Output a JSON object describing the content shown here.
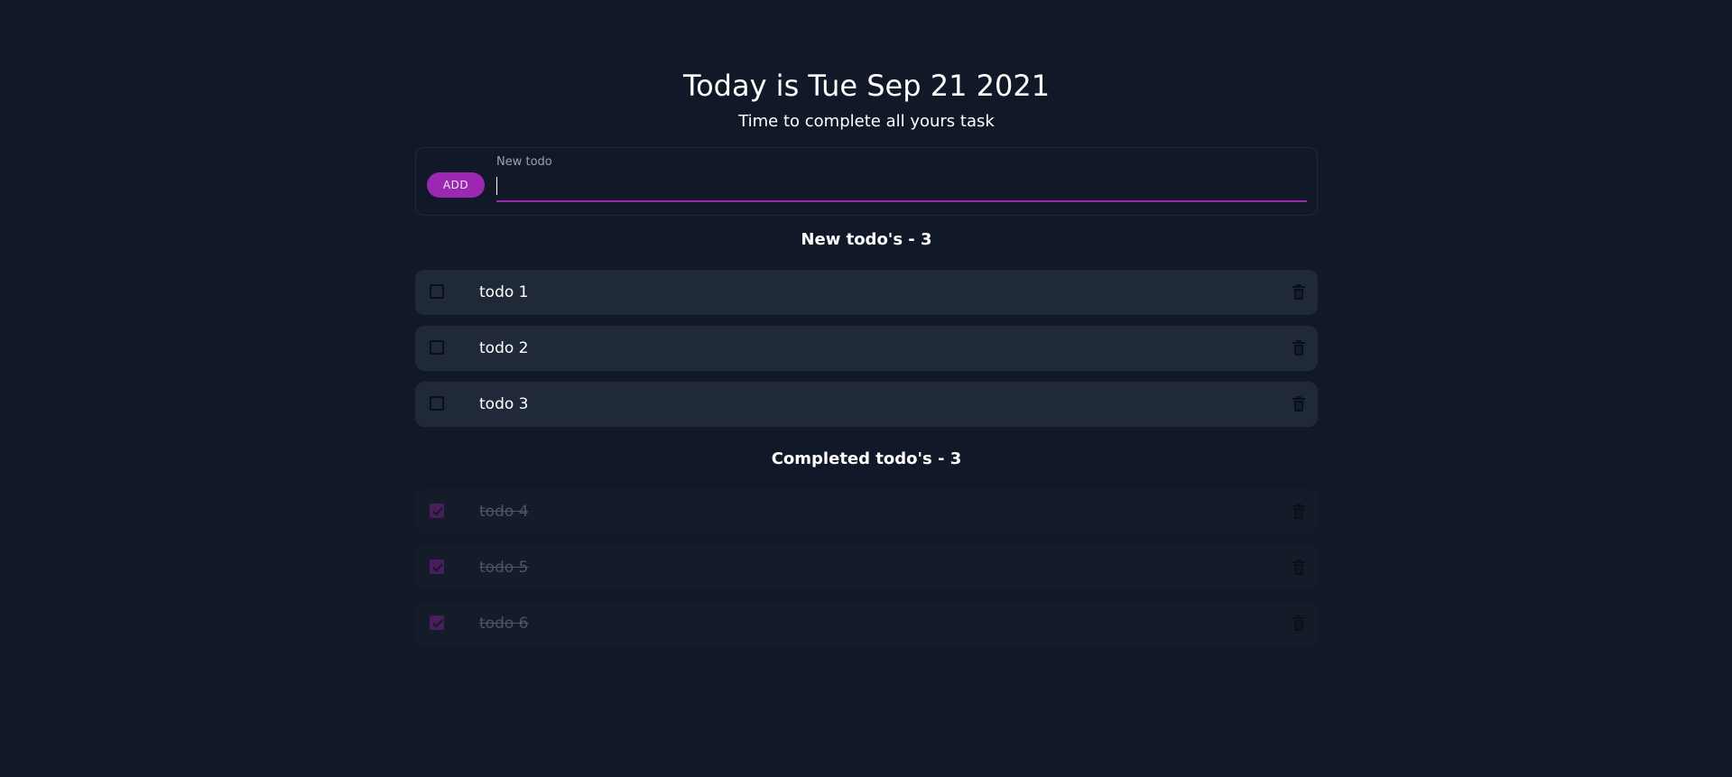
{
  "header": {
    "title": "Today is Tue Sep 21 2021",
    "subtitle": "Time to complete all yours task"
  },
  "new_todo": {
    "button_label": "ADD",
    "field_label": "New todo",
    "value": ""
  },
  "sections": {
    "new_title": "New todo's - 3",
    "completed_title": "Completed todo's - 3"
  },
  "todos": {
    "open": [
      {
        "text": "todo 1",
        "done": false
      },
      {
        "text": "todo 2",
        "done": false
      },
      {
        "text": "todo 3",
        "done": false
      }
    ],
    "completed": [
      {
        "text": "todo 4",
        "done": true
      },
      {
        "text": "todo 5",
        "done": true
      },
      {
        "text": "todo 6",
        "done": true
      }
    ]
  },
  "icons": {
    "checkbox": "checkbox-icon",
    "delete": "trash-icon"
  },
  "colors": {
    "background": "#111827",
    "card": "#1f2937",
    "accent": "#9c27b0"
  }
}
